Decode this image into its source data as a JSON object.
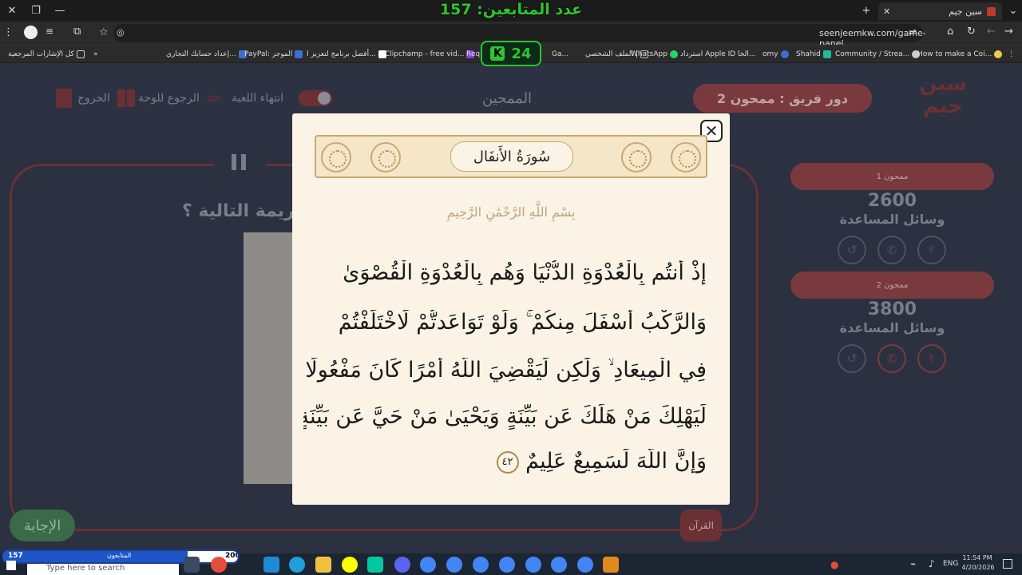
{
  "browser": {
    "overlay_title": "عدد المتابعين: 157",
    "tab_title": "سين جيم",
    "new_tab": "+",
    "url": "seenjeemkw.com/game-panel"
  },
  "bookmarks": [
    {
      "label": "كل الإشارات المرجعية"
    },
    {
      "label": "إعداد حسابك التجاري..."
    },
    {
      "label": "PayPal: الموجز"
    },
    {
      "label": "أفضل برنامج لتعزيز ا..."
    },
    {
      "label": "Clipchamp - free vid..."
    },
    {
      "label": "Requ"
    },
    {
      "label": "Ga..."
    },
    {
      "label": "الملف الشخصي |"
    },
    {
      "label": "WhatsApp"
    },
    {
      "label": "استرداد Apple ID الخا..."
    },
    {
      "label": "omy"
    },
    {
      "label": "Shahid"
    },
    {
      "label": "Community / Strea..."
    },
    {
      "label": "How to make a Coi..."
    }
  ],
  "timer_badge": "24",
  "game": {
    "exit": "الخروج",
    "back_to_board": "الرجوع للوحة",
    "end_game": "انتهاء اللعبة",
    "center_label": "الممحين",
    "turn_label": "دور فريق : ممحون 2",
    "question_partial": "كريمة التالية ؟",
    "answer_button": "الإجابة",
    "quran_button": "القرآن",
    "teams": [
      {
        "name": "ممحون 1",
        "score": "2600",
        "helps": "وسائل المساعدة"
      },
      {
        "name": "ممحون 2",
        "score": "3800",
        "helps": "وسائل المساعدة"
      }
    ]
  },
  "modal": {
    "surah": "سُورَةُ الأَنفَال",
    "basmala": "بِسْمِ اللَّهِ الرَّحْمَٰنِ الرَّحِيمِ",
    "lines": [
      "إِذْ أَنتُم بِالْعُدْوَةِ الدُّنْيَا وَهُم بِالْعُدْوَةِ الْقُصْوَىٰ",
      "وَالرَّكْبُ أَسْفَلَ مِنكُمْ ۚ وَلَوْ تَوَاعَدتُّمْ لَاخْتَلَفْتُمْ",
      "فِي الْمِيعَادِ ۙ وَلَٰكِن لِّيَقْضِيَ اللَّهُ أَمْرًا كَانَ مَفْعُولًا",
      "لِّيَهْلِكَ مَنْ هَلَكَ عَن بَيِّنَةٍ وَيَحْيَىٰ مَنْ حَيَّ عَن بَيِّنَةٍ ۗ",
      "وَإِنَّ اللَّهَ لَسَمِيعٌ عَلِيمٌ"
    ],
    "ayah_number": "٤٢"
  },
  "taskbar": {
    "followers_count": "157",
    "followers_label": "المتابعون",
    "followers_goal": "200",
    "search_placeholder": "Type here to search",
    "lang": "ENG",
    "time": "11:54 PM",
    "date": "4/20/2026"
  }
}
